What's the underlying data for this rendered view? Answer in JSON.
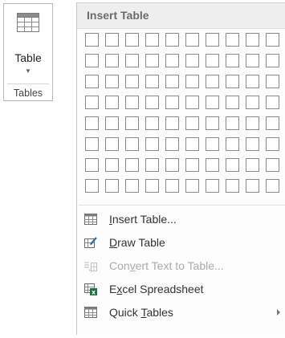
{
  "ribbon": {
    "table_button_label": "Table",
    "group_label": "Tables"
  },
  "menu": {
    "header": "Insert Table",
    "grid": {
      "rows": 8,
      "columns": 10
    },
    "items": [
      {
        "pre": "",
        "key": "I",
        "post": "nsert Table...",
        "icon": "insert-table-icon",
        "enabled": true
      },
      {
        "pre": "",
        "key": "D",
        "post": "raw Table",
        "icon": "draw-table-icon",
        "enabled": true
      },
      {
        "pre": "Con",
        "key": "v",
        "post": "ert Text to Table...",
        "icon": "convert-text-icon",
        "enabled": false
      },
      {
        "pre": "E",
        "key": "x",
        "post": "cel Spreadsheet",
        "icon": "excel-spreadsheet-icon",
        "enabled": true
      },
      {
        "pre": "Quick ",
        "key": "T",
        "post": "ables",
        "icon": "quick-tables-icon",
        "enabled": true,
        "submenu": true
      }
    ]
  }
}
